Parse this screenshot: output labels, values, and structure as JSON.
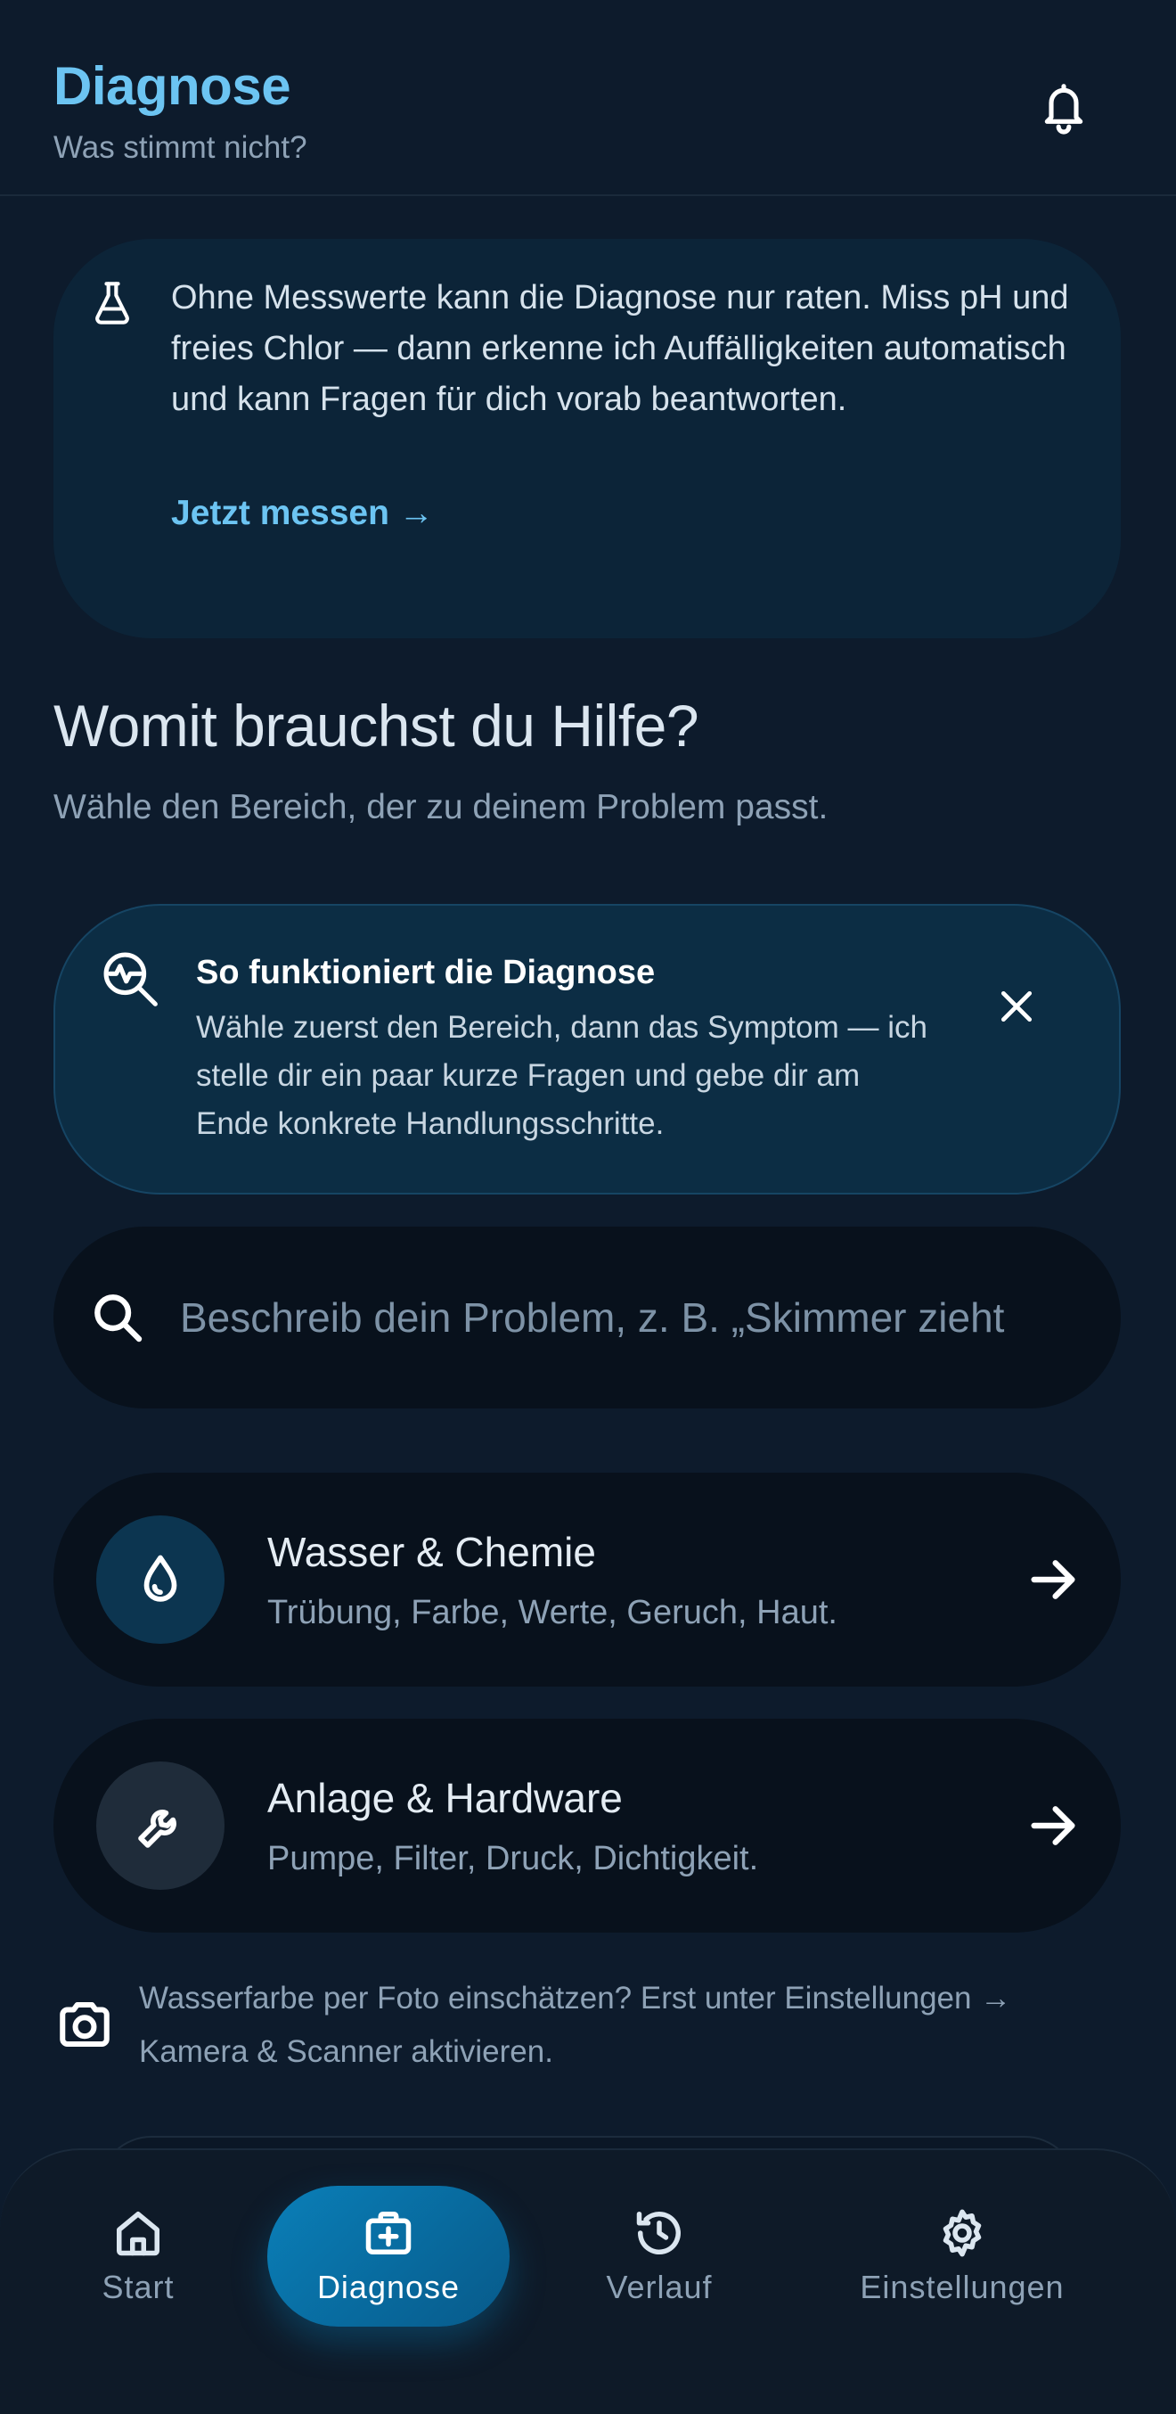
{
  "header": {
    "title": "Diagnose",
    "subtitle": "Was stimmt nicht?",
    "bell_icon": "bell-icon"
  },
  "measure_banner": {
    "icon": "flask-icon",
    "text": "Ohne Messwerte kann die Diagnose nur raten. Miss pH und freies Chlor — dann erkenne ich Auffälligkeiten automatisch und kann Fragen für dich vorab beantworten.",
    "link": "Jetzt messen →"
  },
  "section": {
    "title": "Womit brauchst du Hilfe?",
    "subtitle": "Wähle den Bereich, der zu deinem Problem passt."
  },
  "how_it_works": {
    "icon": "diagnosis-search-icon",
    "title": "So funktioniert die Diagnose",
    "text": "Wähle zuerst den Bereich, dann das Symptom — ich stelle dir ein paar kurze Fragen und gebe dir am Ende konkrete Handlungsschritte.",
    "close_icon": "close-icon"
  },
  "search": {
    "placeholder": "Beschreib dein Problem, z. B. „Skimmer zieht",
    "value": ""
  },
  "categories": [
    {
      "icon": "water-drop-icon",
      "title": "Wasser & Chemie",
      "description": "Trübung, Farbe, Werte, Geruch, Haut."
    },
    {
      "icon": "wrench-icon",
      "title": "Anlage & Hardware",
      "description": "Pumpe, Filter, Druck, Dichtigkeit."
    }
  ],
  "camera_hint": {
    "icon": "camera-icon",
    "text": "Wasserfarbe per Foto einschätzen? Erst unter Einstellungen → Kamera & Scanner aktivieren."
  },
  "nav": {
    "items": [
      {
        "label": "Start",
        "icon": "home-icon"
      },
      {
        "label": "Diagnose",
        "icon": "medical-kit-icon",
        "active": true
      },
      {
        "label": "Verlauf",
        "icon": "history-icon"
      },
      {
        "label": "Einstellungen",
        "icon": "gear-icon"
      }
    ]
  },
  "colors": {
    "background": "#0d1b2c",
    "accent": "#6cc4f2",
    "nav_active": "#0a7fb8",
    "card_dark": "#08111c",
    "info_card": "#0c2438"
  }
}
